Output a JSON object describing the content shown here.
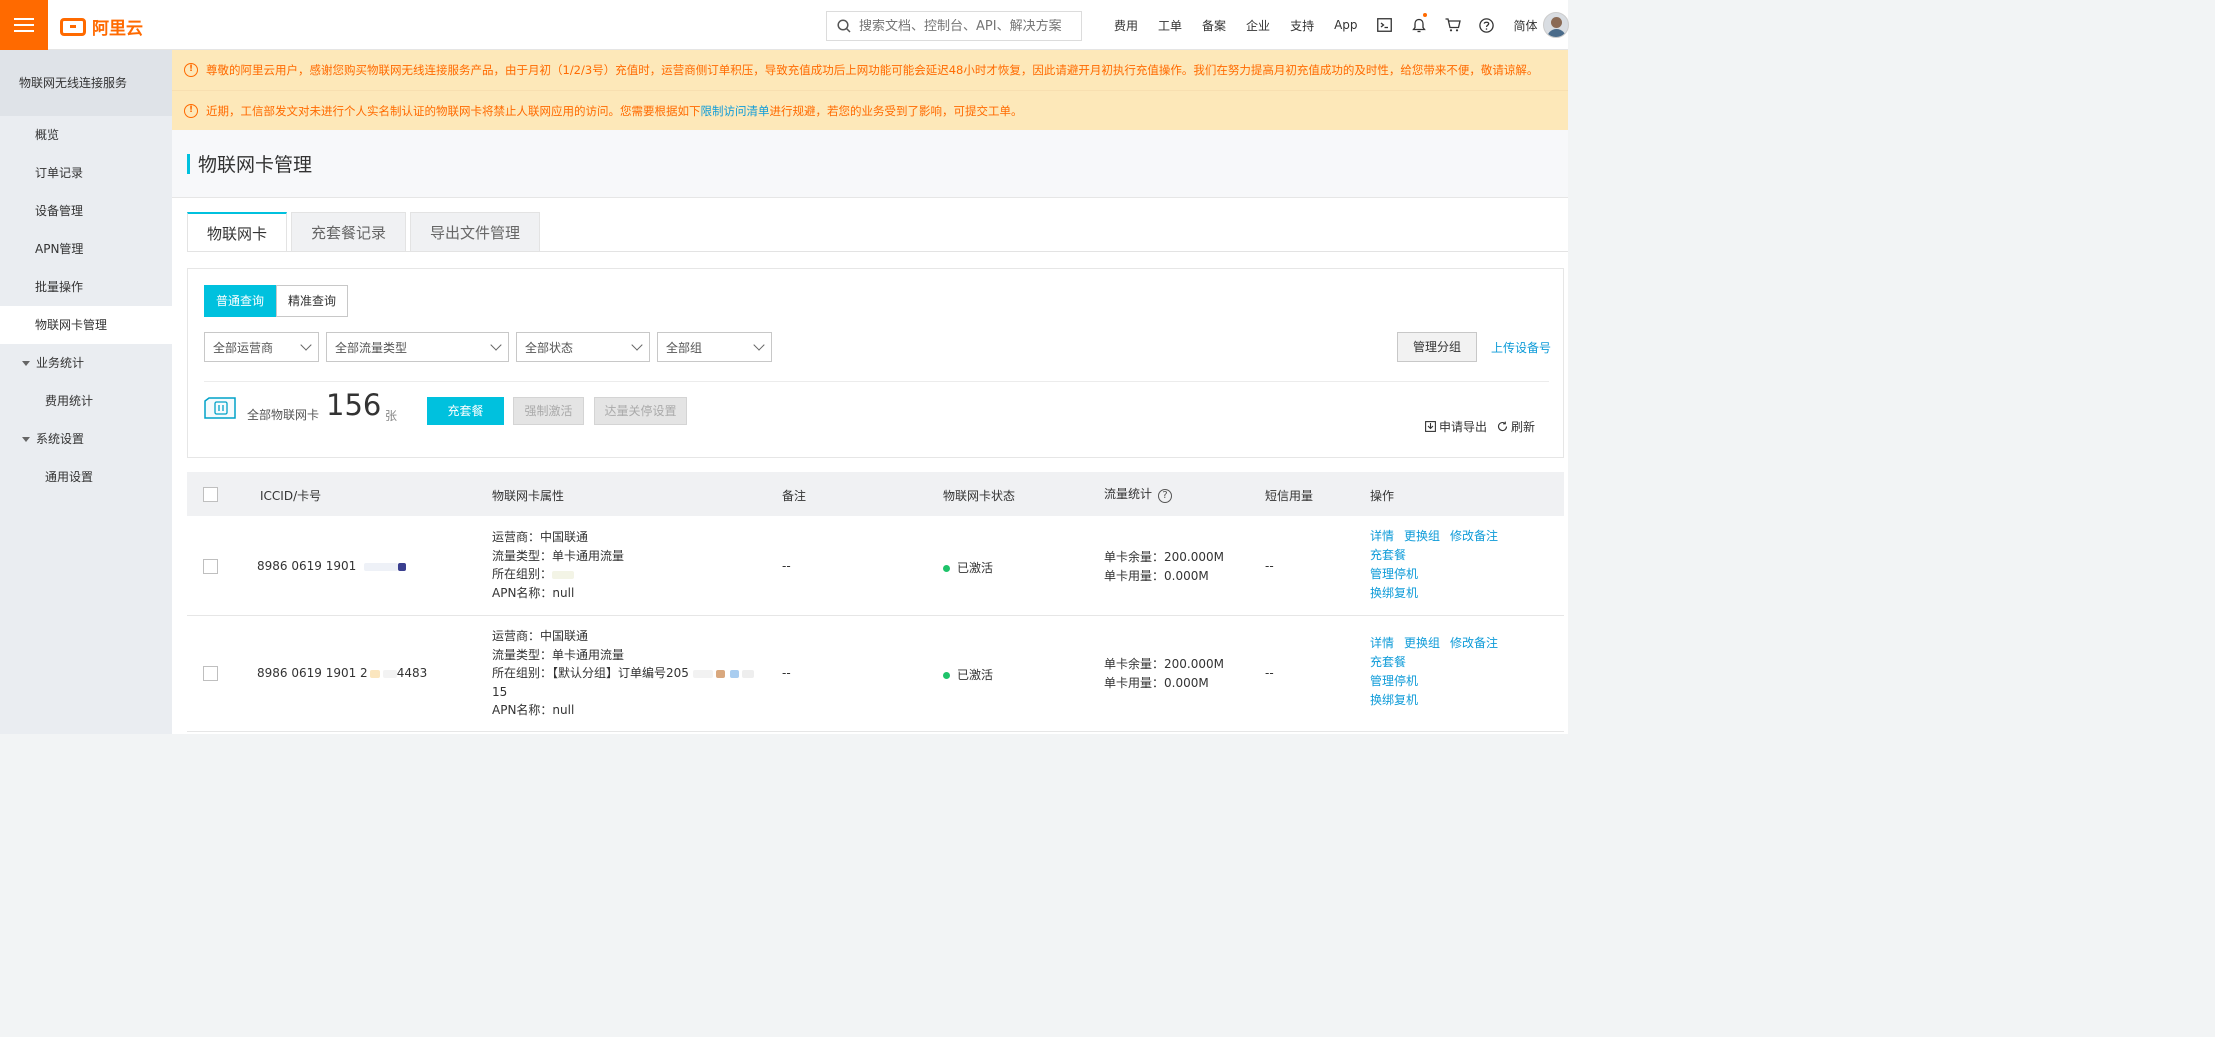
{
  "topbar": {
    "brand": "阿里云",
    "search_placeholder": "搜索文档、控制台、API、解决方案",
    "nav": [
      "费用",
      "工单",
      "备案",
      "企业",
      "支持",
      "App"
    ],
    "language": "简体",
    "icons": [
      "terminal-icon",
      "bell-icon",
      "cart-icon",
      "help-icon"
    ],
    "accent_color": "#ff6a00"
  },
  "sidebar": {
    "product": "物联网无线连接服务",
    "items": [
      {
        "label": "概览"
      },
      {
        "label": "订单记录"
      },
      {
        "label": "设备管理"
      },
      {
        "label": "APN管理"
      },
      {
        "label": "批量操作"
      },
      {
        "label": "物联网卡管理",
        "active": true
      }
    ],
    "groups": [
      {
        "label": "业务统计",
        "children": [
          "费用统计"
        ]
      },
      {
        "label": "系统设置",
        "children": [
          "通用设置"
        ]
      }
    ]
  },
  "notices": {
    "first": "尊敬的阿里云用户，感谢您购买物联网无线连接服务产品，由于月初（1/2/3号）充值时，运营商侧订单积压，导致充值成功后上网功能可能会延迟48小时才恢复，因此请避开月初执行充值操作。我们在努力提高月初充值成功的及时性，给您带来不便，敬请谅解。",
    "second_before": "近期，工信部发文对未进行个人实名制认证的物联网卡将禁止人联网应用的访问。您需要根据如下",
    "second_link": "限制访问清单",
    "second_after": "进行规避，若您的业务受到了影响，可提交工单。"
  },
  "page": {
    "title": "物联网卡管理",
    "tabs": [
      "物联网卡",
      "充套餐记录",
      "导出文件管理"
    ]
  },
  "query": {
    "modes": [
      "普通查询",
      "精准查询"
    ],
    "filters": [
      "全部运营商",
      "全部流量类型",
      "全部状态",
      "全部组"
    ],
    "manage_group": "管理分组",
    "upload_device": "上传设备号"
  },
  "summary": {
    "label": "全部物联网卡",
    "count": "156",
    "unit": "张",
    "recharge": "充套餐",
    "force_activate": "强制激活",
    "threshold_stop": "达量关停设置",
    "export": "申请导出",
    "refresh": "刷新"
  },
  "table": {
    "headers": [
      "ICCID/卡号",
      "物联网卡属性",
      "备注",
      "物联网卡状态",
      "流量统计",
      "短信用量",
      "操作"
    ],
    "rows": [
      {
        "iccid": "8986 0619 1901",
        "carrier": "运营商：中国联通",
        "flow_type": "流量类型：单卡通用流量",
        "group": "所在组别：",
        "group_extra": "",
        "apn": "APN名称：null",
        "remark": "--",
        "status": "已激活",
        "remain": "单卡余量：200.000M",
        "used": "单卡用量：0.000M",
        "sms": "--",
        "ops": [
          "详情",
          "更换组",
          "修改备注",
          "充套餐",
          "管理停机",
          "换绑复机"
        ]
      },
      {
        "iccid": "8986 0619 1901 2",
        "iccid_tail": "4483",
        "carrier": "运营商：中国联通",
        "flow_type": "流量类型：单卡通用流量",
        "group": "所在组别：【默认分组】订单编号205",
        "group_extra": "15",
        "apn": "APN名称：null",
        "remark": "--",
        "status": "已激活",
        "remain": "单卡余量：200.000M",
        "used": "单卡用量：0.000M",
        "sms": "--",
        "ops": [
          "详情",
          "更换组",
          "修改备注",
          "充套餐",
          "管理停机",
          "换绑复机"
        ]
      }
    ]
  }
}
